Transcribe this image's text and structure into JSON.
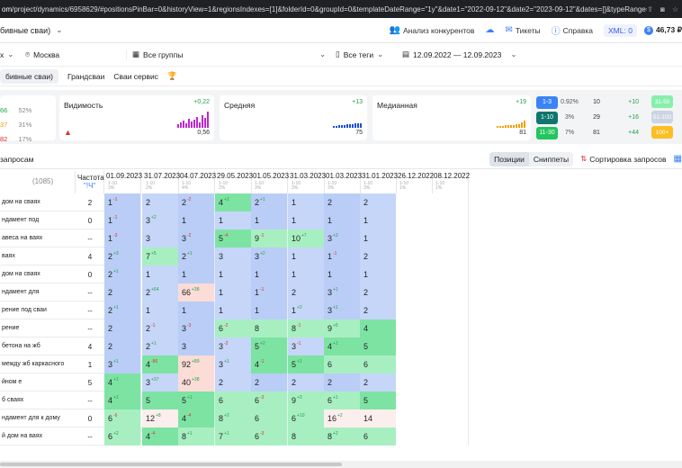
{
  "browser": {
    "url_host": "om",
    "url_rest": "/project/dynamics/6958629/#positionsPinBar=0&historyView=1&regionsIndexes=[1]&folderId=0&groupId=0&templateDateRange=\"1y\"&date1=\"2022-09-12\"&date2=\"2023-09-12\"&dates=[]&typeRange=2&typeRangeCompare=7"
  },
  "topbar": {
    "project": "бивные сваи)",
    "competitors": "Анализ конкурентов",
    "tickets": "Тикеты",
    "help": "Справка",
    "xml": "XML: 0",
    "balance": "46,73 ₽"
  },
  "filters": {
    "search_engine_suffix": "х",
    "city": "Москва",
    "groups": "Все группы",
    "tags": "Все теги",
    "date_range": "12.09.2022 — 12.09.2023"
  },
  "tag_tabs": [
    "бивные сваи)",
    "Грандсваи",
    "Сваи сервис"
  ],
  "metrics": {
    "left": [
      {
        "v": "66",
        "p": "52%",
        "color": "#22a34a"
      },
      {
        "v": "37",
        "p": "31%",
        "color": "#f59f00"
      },
      {
        "v": "82",
        "p": "17%",
        "color": "#e03131"
      }
    ],
    "visibility": {
      "title": "Видимость",
      "delta": "+0,22",
      "value": "0,56"
    },
    "average": {
      "title": "Средняя",
      "delta": "+13",
      "value": "75"
    },
    "median": {
      "title": "Медианная",
      "delta": "+19",
      "value": "81"
    },
    "dist": [
      {
        "range": "1-3",
        "pct": "0.92%",
        "count": "10",
        "delta": "+10",
        "color": "#3b82f6"
      },
      {
        "range": "1-10",
        "pct": "3%",
        "count": "29",
        "delta": "+16",
        "color": "#0f766e"
      },
      {
        "range": "11-30",
        "pct": "7%",
        "count": "81",
        "delta": "+44",
        "color": "#22c55e"
      }
    ],
    "dist_right": [
      {
        "range": "31-50",
        "color": "#86efac"
      },
      {
        "range": "51-100",
        "color": "#cbd5e1"
      },
      {
        "range": "100+",
        "color": "#fbbf24"
      }
    ]
  },
  "table_toolbar": {
    "label": "запросам",
    "positions": "Позиции",
    "snippets": "Сниппеты",
    "sort": "Сортировка запросов"
  },
  "grid": {
    "count": "(1085)",
    "freq_header": "Частота",
    "freq_sub": "\"!Ч\"",
    "dates": [
      "01.09.2023",
      "31.07.2023",
      "04.07.2023",
      "29.05.2023",
      "01.05.2023",
      "31.03.2023",
      "01.03.2023",
      "31.01.2023",
      "26.12.2022",
      "08.12.2022"
    ],
    "date_subs": [
      [
        "1-10",
        "3%"
      ],
      [
        "1-10",
        "2%"
      ],
      [
        "1-10",
        "4%"
      ],
      [
        "1-10",
        "2%"
      ],
      [
        "1-10",
        "3%"
      ],
      [
        "1-10",
        "3%"
      ],
      [
        "1-10",
        "3%"
      ],
      [
        "1-10",
        "3%"
      ],
      [
        "1-10",
        "1%"
      ],
      [
        "1-10",
        "1%"
      ]
    ],
    "rows": [
      {
        "q": "дом на сваях",
        "f": "2",
        "c": [
          [
            "1",
            "-1"
          ],
          [
            "2",
            ""
          ],
          [
            "2",
            "-2"
          ],
          [
            "4",
            "+2"
          ],
          [
            "2",
            "+1"
          ],
          [
            "1",
            ""
          ],
          [
            "2",
            ""
          ],
          [
            "2",
            ""
          ],
          [
            "",
            ""
          ],
          [
            "",
            ""
          ]
        ]
      },
      {
        "q": "ндамент под",
        "f": "0",
        "c": [
          [
            "1",
            "-1"
          ],
          [
            "3",
            "+2"
          ],
          [
            "1",
            ""
          ],
          [
            "1",
            ""
          ],
          [
            "1",
            ""
          ],
          [
            "1",
            ""
          ],
          [
            "1",
            ""
          ],
          [
            "1",
            ""
          ],
          [
            "",
            ""
          ],
          [
            "",
            ""
          ]
        ]
      },
      {
        "q": "авеса на ваях",
        "f": "--",
        "c": [
          [
            "1",
            "-3"
          ],
          [
            "3",
            ""
          ],
          [
            "3",
            "-2"
          ],
          [
            "5",
            "-4"
          ],
          [
            "9",
            "-1"
          ],
          [
            "10",
            "+7"
          ],
          [
            "3",
            "+2"
          ],
          [
            "1",
            ""
          ],
          [
            "",
            ""
          ],
          [
            "",
            ""
          ]
        ]
      },
      {
        "q": "ваях",
        "f": "4",
        "c": [
          [
            "2",
            "+3"
          ],
          [
            "7",
            "+5"
          ],
          [
            "2",
            "+1"
          ],
          [
            "3",
            ""
          ],
          [
            "3",
            "+2"
          ],
          [
            "1",
            ""
          ],
          [
            "1",
            "-1"
          ],
          [
            "2",
            ""
          ],
          [
            "",
            ""
          ],
          [
            "",
            ""
          ]
        ]
      },
      {
        "q": "дом на сваях",
        "f": "0",
        "c": [
          [
            "2",
            "+1"
          ],
          [
            "1",
            ""
          ],
          [
            "1",
            ""
          ],
          [
            "1",
            ""
          ],
          [
            "1",
            ""
          ],
          [
            "1",
            ""
          ],
          [
            "1",
            ""
          ],
          [
            "1",
            ""
          ],
          [
            "",
            ""
          ],
          [
            "",
            ""
          ]
        ]
      },
      {
        "q": "ндамент для",
        "f": "--",
        "c": [
          [
            "2",
            ""
          ],
          [
            "2",
            "+64"
          ],
          [
            "66",
            "+38"
          ],
          [
            "1",
            ""
          ],
          [
            "1",
            "-1"
          ],
          [
            "2",
            ""
          ],
          [
            "3",
            "+1"
          ],
          [
            "2",
            ""
          ],
          [
            "",
            ""
          ],
          [
            "",
            ""
          ]
        ]
      },
      {
        "q": "рение под сваи",
        "f": "--",
        "c": [
          [
            "2",
            "+1"
          ],
          [
            "1",
            ""
          ],
          [
            "1",
            ""
          ],
          [
            "1",
            ""
          ],
          [
            "1",
            ""
          ],
          [
            "1",
            "+2"
          ],
          [
            "3",
            "+1"
          ],
          [
            "2",
            ""
          ],
          [
            "",
            ""
          ],
          [
            "",
            ""
          ]
        ]
      },
      {
        "q": "рение",
        "f": "--",
        "c": [
          [
            "2",
            ""
          ],
          [
            "2",
            "-1"
          ],
          [
            "3",
            "-3"
          ],
          [
            "6",
            "-2"
          ],
          [
            "8",
            ""
          ],
          [
            "8",
            "-1"
          ],
          [
            "9",
            "+5"
          ],
          [
            "4",
            ""
          ],
          [
            "",
            ""
          ],
          [
            "",
            ""
          ]
        ]
      },
      {
        "q": "бетона на жб",
        "f": "4",
        "c": [
          [
            "2",
            ""
          ],
          [
            "2",
            "+1"
          ],
          [
            "3",
            ""
          ],
          [
            "3",
            "-2"
          ],
          [
            "5",
            "+2"
          ],
          [
            "3",
            "-1"
          ],
          [
            "4",
            "+1"
          ],
          [
            "5",
            ""
          ],
          [
            "",
            ""
          ],
          [
            "",
            ""
          ]
        ]
      },
      {
        "q": "между жб каркасного",
        "f": "1",
        "c": [
          [
            "3",
            "+1"
          ],
          [
            "4",
            "-86"
          ],
          [
            "92",
            "+89"
          ],
          [
            "3",
            "+1"
          ],
          [
            "4",
            "-1"
          ],
          [
            "5",
            "+1"
          ],
          [
            "6",
            ""
          ],
          [
            "6",
            ""
          ],
          [
            "",
            ""
          ],
          [
            "",
            ""
          ]
        ]
      },
      {
        "q": "йном е",
        "f": "5",
        "c": [
          [
            "4",
            "+1"
          ],
          [
            "3",
            "+37"
          ],
          [
            "40",
            "+38"
          ],
          [
            "2",
            ""
          ],
          [
            "2",
            ""
          ],
          [
            "2",
            ""
          ],
          [
            "2",
            ""
          ],
          [
            "2",
            ""
          ],
          [
            "",
            ""
          ],
          [
            "",
            ""
          ]
        ]
      },
      {
        "q": "б сваях",
        "f": "--",
        "c": [
          [
            "4",
            "+1"
          ],
          [
            "5",
            ""
          ],
          [
            "5",
            "+1"
          ],
          [
            "6",
            ""
          ],
          [
            "6",
            "-3"
          ],
          [
            "9",
            "+3"
          ],
          [
            "6",
            "+1"
          ],
          [
            "5",
            ""
          ],
          [
            "",
            ""
          ],
          [
            "",
            ""
          ]
        ]
      },
      {
        "q": "ндамент для к дому",
        "f": "0",
        "c": [
          [
            "6",
            "-6"
          ],
          [
            "12",
            "+8"
          ],
          [
            "4",
            "-4"
          ],
          [
            "8",
            "+2"
          ],
          [
            "6",
            ""
          ],
          [
            "6",
            "+10"
          ],
          [
            "16",
            "+2"
          ],
          [
            "14",
            ""
          ],
          [
            "",
            ""
          ],
          [
            "",
            ""
          ]
        ]
      },
      {
        "q": "й дом на ваях",
        "f": "--",
        "c": [
          [
            "6",
            "+2"
          ],
          [
            "4",
            "-4"
          ],
          [
            "8",
            "+1"
          ],
          [
            "7",
            "+1"
          ],
          [
            "6",
            "-3"
          ],
          [
            "8",
            ""
          ],
          [
            "8",
            "+2"
          ],
          [
            "6",
            ""
          ],
          [
            "",
            ""
          ],
          [
            "",
            ""
          ]
        ]
      }
    ]
  }
}
